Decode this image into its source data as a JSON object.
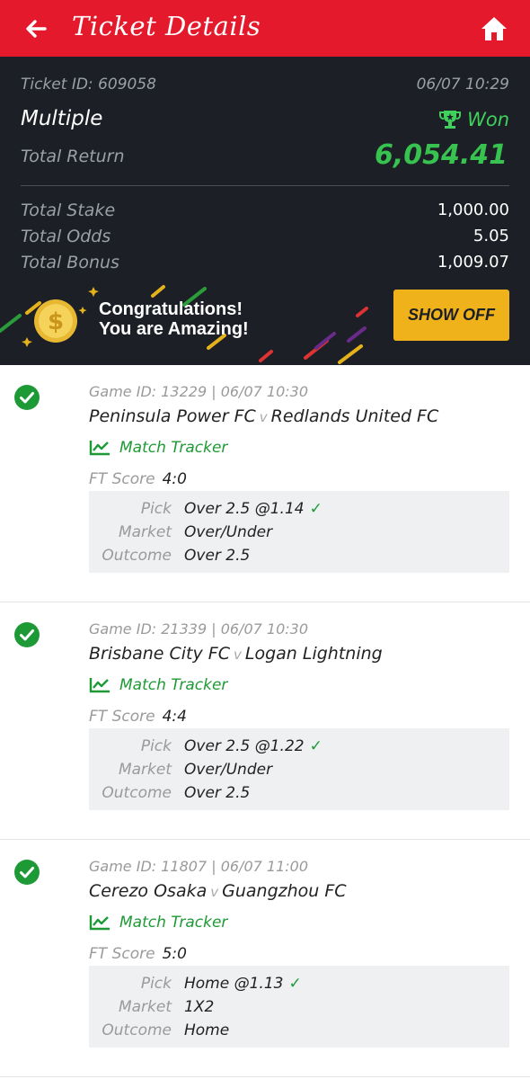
{
  "header": {
    "title": "Ticket Details",
    "back_icon": "arrow-left-icon",
    "home_icon": "home-icon",
    "bg_color": "#e41a2c"
  },
  "summary": {
    "ticket_id": "Ticket ID: 609058",
    "datetime": "06/07 10:29",
    "bet_type": "Multiple",
    "status": "Won",
    "status_icon": "trophy-icon",
    "total_return_label": "Total Return",
    "total_return_value": "6,054.41",
    "total_stake_label": "Total Stake",
    "total_stake_value": "1,000.00",
    "total_odds_label": "Total Odds",
    "total_odds_value": "5.05",
    "total_bonus_label": "Total Bonus",
    "total_bonus_value": "1,009.07",
    "promo_line1": "Congratulations!",
    "promo_line2": "You are Amazing!",
    "promo_icon": "gold-coin-icon",
    "show_off_label": "SHOW OFF",
    "accent_green": "#38c24f",
    "button_color": "#f0b21b"
  },
  "games": [
    {
      "meta": "Game ID: 13229 | 06/07 10:30",
      "home": "Peninsula Power FC",
      "vs": "v",
      "away": "Redlands United FC",
      "tracker": "Match Tracker",
      "score_label": "FT Score",
      "score": "4:0",
      "pick_label": "Pick",
      "pick": "Over 2.5 @1.14",
      "market_label": "Market",
      "market": "Over/Under",
      "outcome_label": "Outcome",
      "outcome": "Over 2.5"
    },
    {
      "meta": "Game ID: 21339 | 06/07 10:30",
      "home": "Brisbane City FC",
      "vs": "v",
      "away": "Logan Lightning",
      "tracker": "Match Tracker",
      "score_label": "FT Score",
      "score": "4:4",
      "pick_label": "Pick",
      "pick": "Over 2.5 @1.22",
      "market_label": "Market",
      "market": "Over/Under",
      "outcome_label": "Outcome",
      "outcome": "Over 2.5"
    },
    {
      "meta": "Game ID: 11807 | 06/07 11:00",
      "home": "Cerezo Osaka",
      "vs": "v",
      "away": "Guangzhou FC",
      "tracker": "Match Tracker",
      "score_label": "FT Score",
      "score": "5:0",
      "pick_label": "Pick",
      "pick": "Home @1.13",
      "market_label": "Market",
      "market": "1X2",
      "outcome_label": "Outcome",
      "outcome": "Home"
    }
  ]
}
